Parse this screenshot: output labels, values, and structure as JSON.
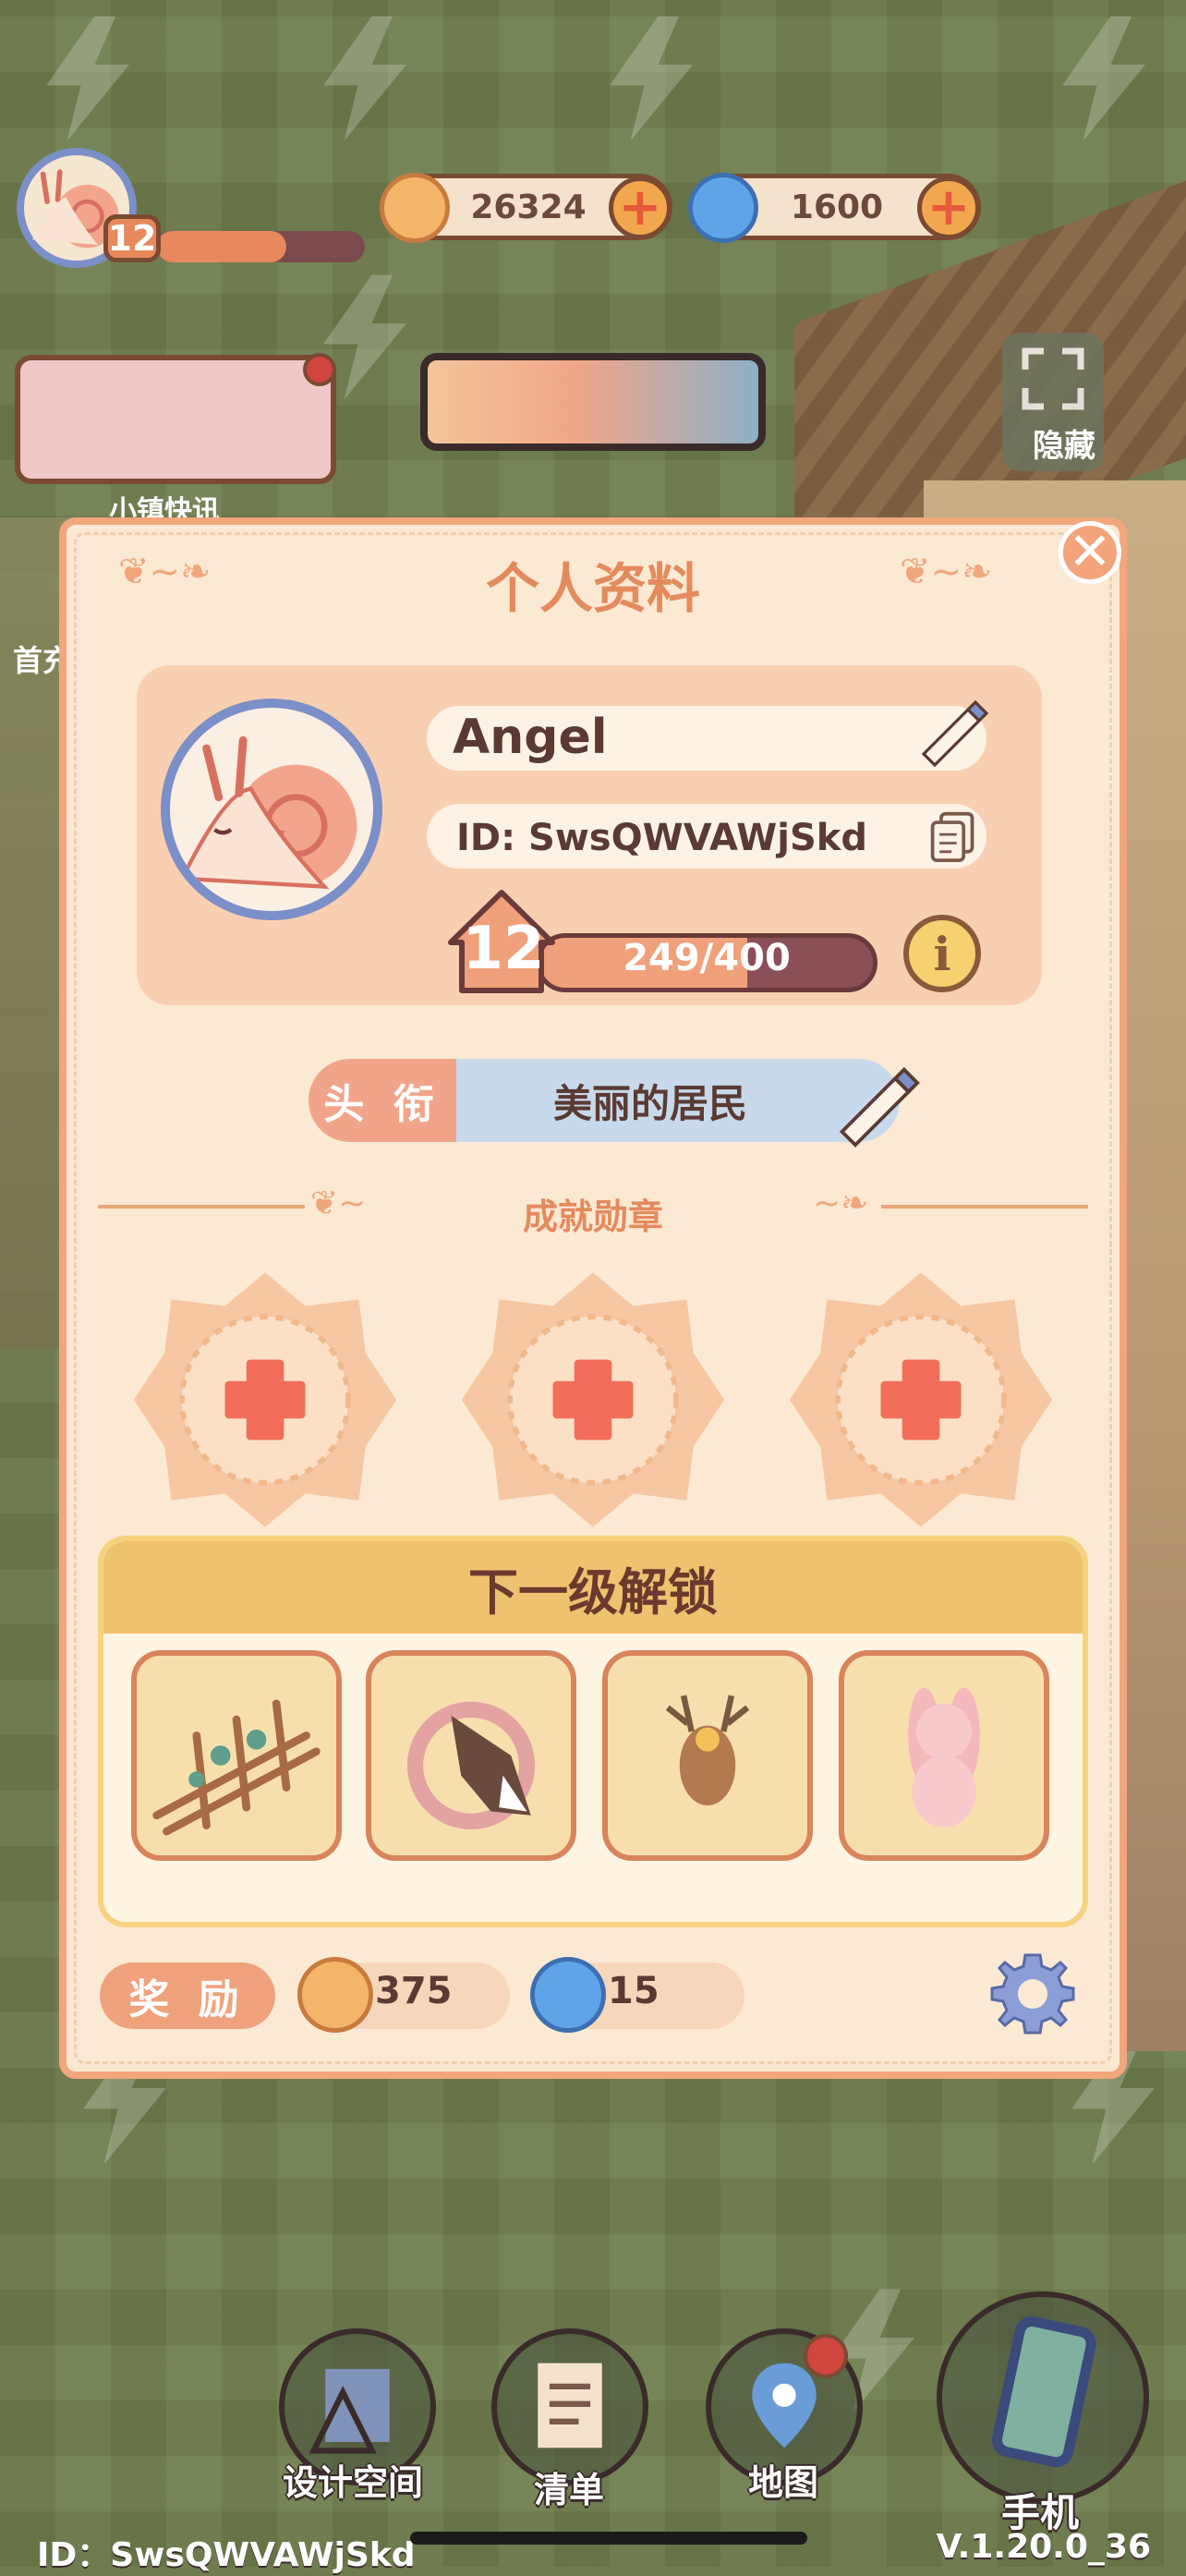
{
  "hud": {
    "level": "12",
    "level_progress": 0.62,
    "coins": "26324",
    "gems": "1600",
    "news_label": "小镇快讯",
    "first_left_label": "首充",
    "hide_label": "隐藏"
  },
  "panel": {
    "title": "个人资料",
    "name": "Angel",
    "id": "ID: SwsQWVAWjSkd",
    "level": "12",
    "xp_text": "249/400",
    "xp_fraction": 0.6225,
    "info_symbol": "i",
    "title_tag": "头 衔",
    "title_value": "美丽的居民",
    "achievements_label": "成就勋章",
    "unlock_header": "下一级解锁",
    "unlock_items": [
      {
        "icon": "plant-trellis-icon"
      },
      {
        "icon": "horse-head-wreath-icon"
      },
      {
        "icon": "deer-head-icon"
      },
      {
        "icon": "bunny-plush-icon"
      }
    ],
    "reward_label": "奖 励",
    "reward_coins": "375",
    "reward_gems": "15",
    "close_symbol": "✕"
  },
  "dock": {
    "design": "设计空间",
    "list": "清单",
    "map": "地图",
    "phone": "手机"
  },
  "footer": {
    "id": "ID：SwsQWVAWjSkd",
    "version": "V.1.20.0_36"
  },
  "colors": {
    "accent": "#e48b5e",
    "panel_bg": "#fbe9d4",
    "panel_border": "#f2a67c"
  }
}
